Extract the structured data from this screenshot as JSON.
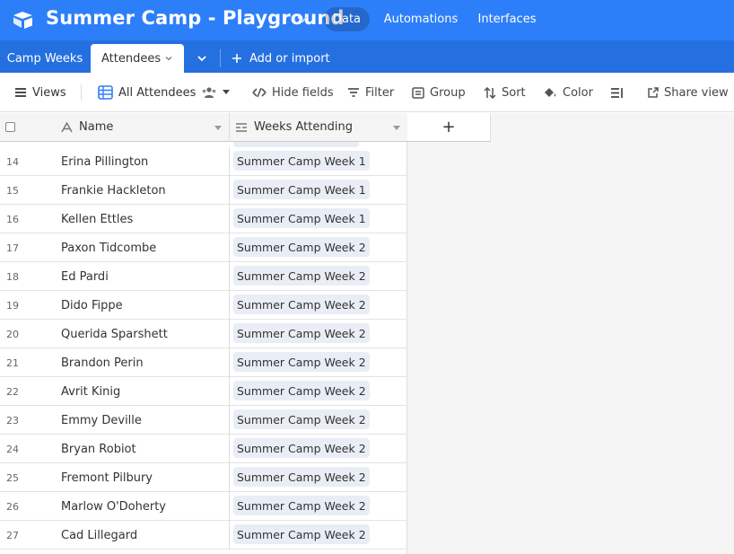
{
  "app": {
    "title": "Summer Camp - Playground",
    "nav": {
      "data": "Data",
      "automations": "Automations",
      "interfaces": "Interfaces"
    },
    "brand_color": "#2d7ff9"
  },
  "tabs": {
    "camp_weeks": "Camp Weeks",
    "attendees": "Attendees",
    "add_or_import": "Add or import"
  },
  "toolbar": {
    "views": "Views",
    "current_view": "All Attendees",
    "hide_fields": "Hide fields",
    "filter": "Filter",
    "group": "Group",
    "sort": "Sort",
    "color": "Color",
    "share_view": "Share view"
  },
  "grid": {
    "columns": {
      "name": "Name",
      "weeks": "Weeks Attending"
    },
    "add_column": "+",
    "rows": [
      {
        "num": "14",
        "name": "Erina Pillington",
        "week": "Summer Camp Week 1"
      },
      {
        "num": "15",
        "name": "Frankie Hackleton",
        "week": "Summer Camp Week 1"
      },
      {
        "num": "16",
        "name": "Kellen Ettles",
        "week": "Summer Camp Week 1"
      },
      {
        "num": "17",
        "name": "Paxon Tidcombe",
        "week": "Summer Camp Week 2"
      },
      {
        "num": "18",
        "name": "Ed Pardi",
        "week": "Summer Camp Week 2"
      },
      {
        "num": "19",
        "name": "Dido Fippe",
        "week": "Summer Camp Week 2"
      },
      {
        "num": "20",
        "name": "Querida Sparshett",
        "week": "Summer Camp Week 2"
      },
      {
        "num": "21",
        "name": "Brandon Perin",
        "week": "Summer Camp Week 2"
      },
      {
        "num": "22",
        "name": "Avrit Kinig",
        "week": "Summer Camp Week 2"
      },
      {
        "num": "23",
        "name": "Emmy Deville",
        "week": "Summer Camp Week 2"
      },
      {
        "num": "24",
        "name": "Bryan Robiot",
        "week": "Summer Camp Week 2"
      },
      {
        "num": "25",
        "name": "Fremont Pilbury",
        "week": "Summer Camp Week 2"
      },
      {
        "num": "26",
        "name": "Marlow O'Doherty",
        "week": "Summer Camp Week 2"
      },
      {
        "num": "27",
        "name": "Cad Lillegard",
        "week": "Summer Camp Week 2"
      }
    ]
  }
}
